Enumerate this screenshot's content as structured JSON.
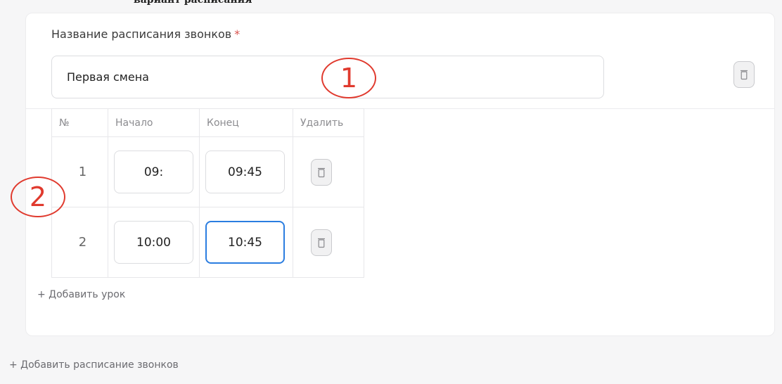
{
  "top_cut_text": "вариант расписания",
  "schedule": {
    "name_label": "Название расписания звонков",
    "required_mark": "*",
    "name_value": "Первая смена",
    "delete_icon": "trash-icon"
  },
  "lessons_table": {
    "headers": [
      "№",
      "Начало",
      "Конец",
      "Удалить"
    ],
    "rows": [
      {
        "num": "1",
        "start": "09:",
        "end": "09:45"
      },
      {
        "num": "2",
        "start": "10:00",
        "end": "10:45"
      }
    ]
  },
  "add_lesson_label": "+ Добавить урок",
  "add_schedule_label": "+ Добавить расписание звонков",
  "annotations": [
    "1",
    "2"
  ],
  "colors": {
    "annotation": "#e03a2e",
    "focus_border": "#2b7de0",
    "required": "#d9534f"
  }
}
